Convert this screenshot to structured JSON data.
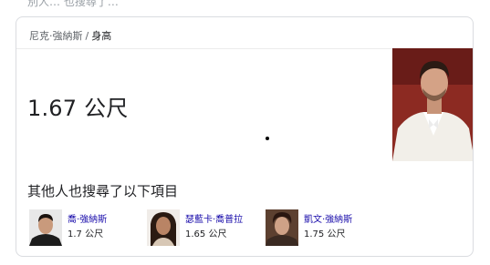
{
  "top_fragment": "別人…  也搜尋了…",
  "breadcrumb": {
    "parent": "尼克·強納斯",
    "separator": "/",
    "current": "身高"
  },
  "answer": {
    "height_text": "1.67 公尺"
  },
  "others": {
    "title": "其他人也搜尋了以下項目",
    "people": [
      {
        "name": "喬·強納斯",
        "height": "1.7 公尺"
      },
      {
        "name": "瑟藍卡·喬普拉",
        "height": "1.65 公尺"
      },
      {
        "name": "凱文·強納斯",
        "height": "1.75 公尺"
      }
    ]
  }
}
